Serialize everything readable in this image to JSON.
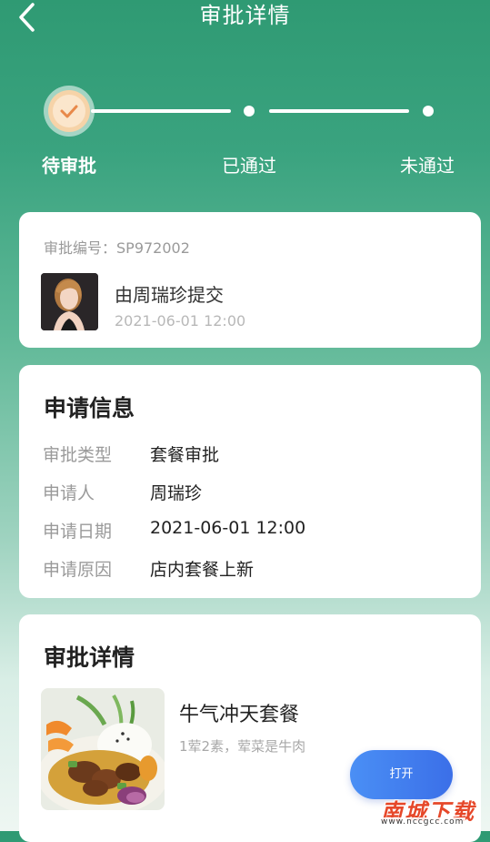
{
  "header": {
    "title": "审批详情",
    "back_icon": "chevron-left-icon"
  },
  "stepper": {
    "steps": [
      {
        "label": "待审批",
        "state": "current"
      },
      {
        "label": "已通过",
        "state": "pending"
      },
      {
        "label": "未通过",
        "state": "pending"
      }
    ],
    "check_icon": "check-icon",
    "active_color": "#f6d3a8",
    "check_color": "#e8894a"
  },
  "summary": {
    "approval_no_label": "审批编号：",
    "approval_no": "SP972002",
    "submitter_text": "由周瑞珍提交",
    "submit_time": "2021-06-01 12:00",
    "avatar": "avatar-photo"
  },
  "apply_info": {
    "title": "申请信息",
    "rows": [
      {
        "key": "审批类型",
        "value": "套餐审批"
      },
      {
        "key": "申请人",
        "value": "周瑞珍"
      },
      {
        "key": "申请日期",
        "value": "2021-06-01 12:00"
      },
      {
        "key": "申请原因",
        "value": "店内套餐上新"
      }
    ]
  },
  "approval_detail": {
    "title": "审批详情",
    "meal_name": "牛气冲天套餐",
    "meal_desc": "1荤2素，荤菜是牛肉",
    "meal_image": "food-photo"
  },
  "open_button": {
    "label": "打开",
    "color": "#4a8ff5"
  },
  "watermark": {
    "text": "南城下载",
    "url": "www.nccgcc.com"
  }
}
